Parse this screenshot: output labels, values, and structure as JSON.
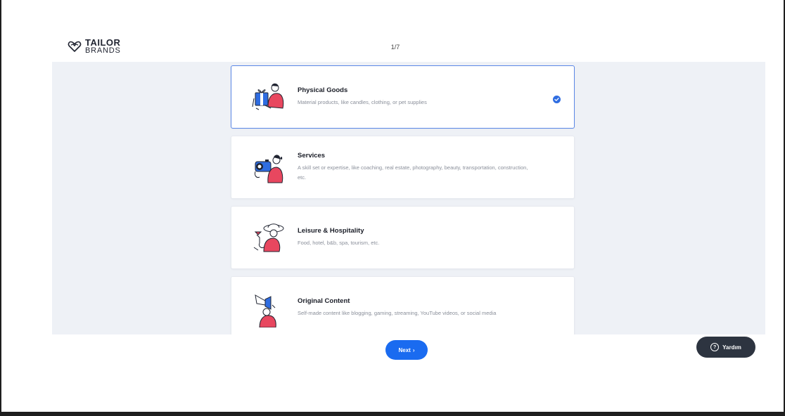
{
  "brand": {
    "name_top": "TAILOR",
    "name_bottom": "BRANDS"
  },
  "progress": {
    "step_label": "1/7",
    "current": 1,
    "total": 7
  },
  "options": [
    {
      "title": "Physical Goods",
      "description": "Material products, like candles, clothing, or pet supplies",
      "selected": true,
      "icon": "gift-person-illustration"
    },
    {
      "title": "Services",
      "description": "A skill set or expertise, like coaching, real estate, photography, beauty, transportation, construction, etc.",
      "selected": false,
      "icon": "camera-person-illustration"
    },
    {
      "title": "Leisure & Hospitality",
      "description": "Food, hotel, b&b, spa, tourism, etc.",
      "selected": false,
      "icon": "hat-person-illustration"
    },
    {
      "title": "Original Content",
      "description": "Self-made content like blogging, gaming, streaming, YouTube videos, or social media",
      "selected": false,
      "icon": "megaphone-person-illustration"
    }
  ],
  "buttons": {
    "next_label": "Next",
    "help_label": "Yardım"
  },
  "colors": {
    "accent": "#1a6bf0",
    "selected_border": "#5a87e6",
    "illustration_red": "#e8475f",
    "illustration_blue": "#2f6de1",
    "background": "#eef1f6",
    "help_button": "#2d3440"
  }
}
